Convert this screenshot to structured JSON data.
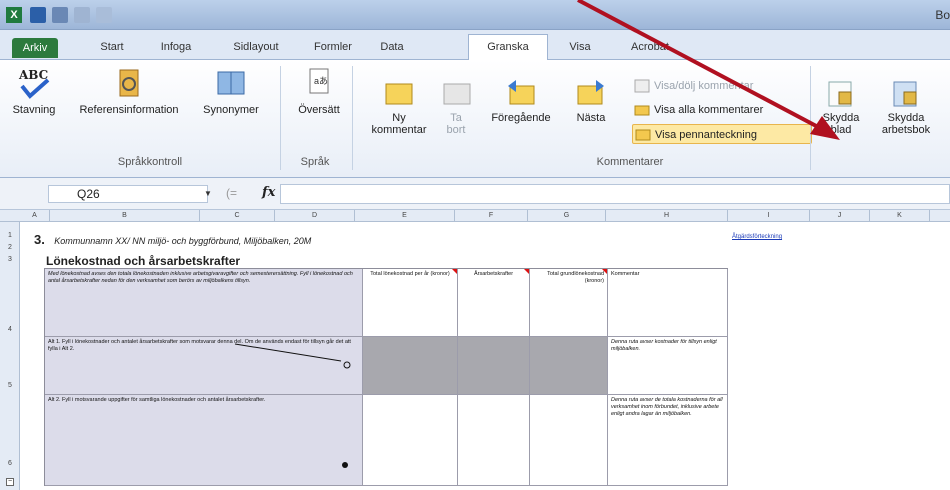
{
  "window": {
    "title": "Bok"
  },
  "tabs": [
    "Arkiv",
    "Start",
    "Infoga",
    "Sidlayout",
    "Formler",
    "Data",
    "Granska",
    "Visa",
    "Acrobat"
  ],
  "active_tab": "Granska",
  "ribbon": {
    "stavning": "Stavning",
    "referens": "Referensinformation",
    "synonymer": "Synonymer",
    "oversatt": "Översätt",
    "ny_kommentar": "Ny kommentar",
    "ta_bort": "Ta bort",
    "foregaende": "Föregående",
    "nasta": "Nästa",
    "visa_dolj": "Visa/dölj kommentar",
    "visa_alla": "Visa alla kommentarer",
    "visa_penn": "Visa pennanteckning",
    "skydda_blad": "Skydda blad",
    "skydda_arbetsbok": "Skydda arbetsbok",
    "group_sprakkontroll": "Språkkontroll",
    "group_sprak": "Språk",
    "group_kommentarer": "Kommentarer"
  },
  "formula_bar": {
    "name_box": "Q26",
    "fx": "fx",
    "formula": ""
  },
  "columns": [
    "A",
    "B",
    "C",
    "D",
    "E",
    "F",
    "G",
    "H",
    "I",
    "J",
    "K"
  ],
  "rows": [
    "1",
    "2",
    "3",
    "4",
    "5",
    "6"
  ],
  "sheet": {
    "heading_num": "3.",
    "heading_text": "Kommunnamn XX/ NN miljö- och byggförbund, Miljöbalken, 20M",
    "link": "Åtgärdsförteckning",
    "section_title": "Lönekostnad och årsarbetskrafter",
    "col_total": "Total lönekostnad per år (kronor)",
    "col_arbets": "Årsarbetskrafter",
    "col_tim": "Total grundlönekostnad (kronor)",
    "col_komm": "Kommentar",
    "intro": "Med lönekostnad avses den totala lönekostnaden inklusive arbetsgivaravgifter och semesterersättning. Fyll i lönekostnad och antal årsarbetskrafter nedan för den verksamhet som berörs av miljöbalkens tillsyn.",
    "step1": "Alt 1. Fyll i lönekostnader och antalet årsarbetskrafter som motsvarar denna del. Om de används endast för tillsyn går det att fylla i Alt 2.",
    "step1_comment": "Denna ruta avser kostnader för tillsyn enligt miljöbalken.",
    "step2": "Alt 2. Fyll i motsvarande uppgifter för samtliga lönekostnader och antalet årsarbetskrafter.",
    "step2_comment": "Denna ruta avser de totala kostnaderna för all verksamhet inom förbundet, inklusive arbete enligt andra lagar än miljöbalken."
  }
}
